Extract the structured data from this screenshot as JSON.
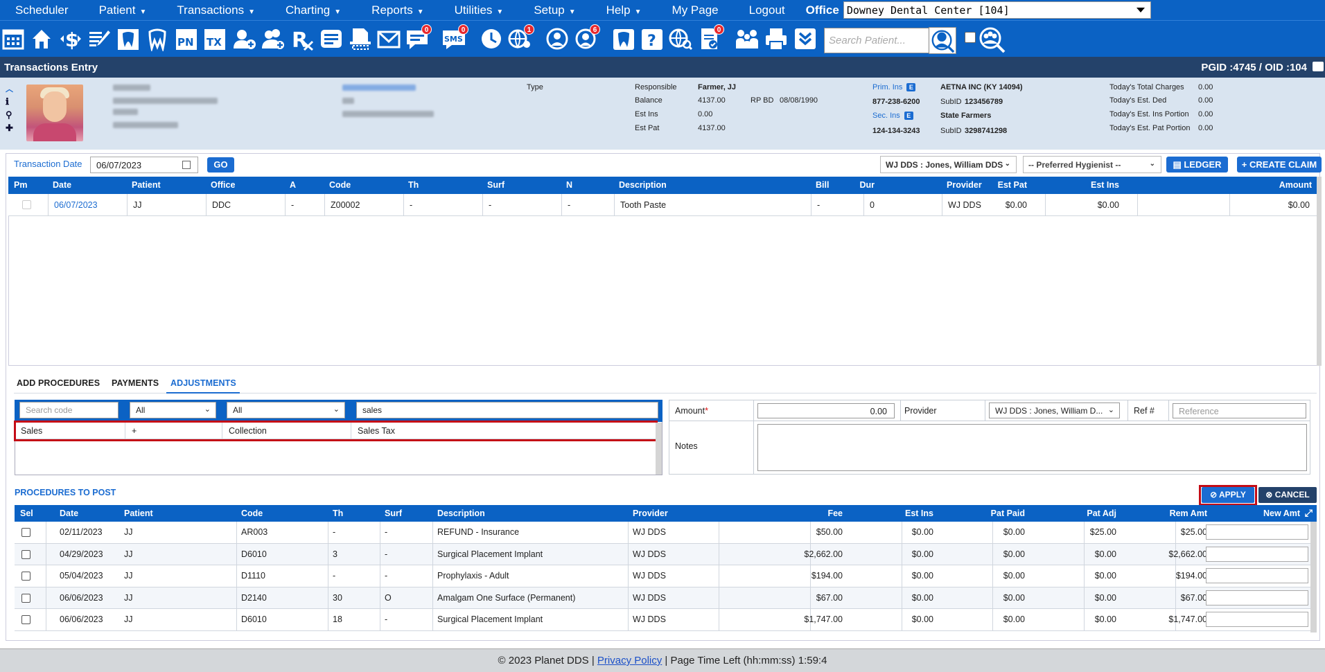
{
  "menu": {
    "items": [
      "Scheduler",
      "Patient",
      "Transactions",
      "Charting",
      "Reports",
      "Utilities",
      "Setup",
      "Help",
      "My Page",
      "Logout"
    ],
    "office_label": "Office",
    "office_value": "Downey Dental Center [104]"
  },
  "toolbar": {
    "search_placeholder": "Search Patient...",
    "badges": {
      "messages": "0",
      "sms": "0",
      "globe": "1",
      "recall": "6",
      "forms": "0"
    },
    "pn_label": "PN",
    "tx_label": "TX",
    "sms_label": "SMS"
  },
  "title": {
    "left": "Transactions Entry",
    "right": "PGID :4745  /  OID :104"
  },
  "patient": {
    "type_label": "Type",
    "responsible_label": "Responsible",
    "responsible": "Farmer, JJ",
    "balance_label": "Balance",
    "balance": "4137.00",
    "rpbd_label": "RP BD",
    "rpbd": "08/08/1990",
    "estins_label": "Est Ins",
    "estins": "0.00",
    "estpat_label": "Est Pat",
    "estpat": "4137.00",
    "prim_ins_label": "Prim. Ins",
    "prim_ins": "AETNA INC (KY 14094)",
    "prim_phone": "877-238-6200",
    "prim_subid_label": "SubID",
    "prim_subid": "123456789",
    "sec_ins_label": "Sec. Ins",
    "sec_ins": "State Farmers",
    "sec_phone": "124-134-3243",
    "sec_subid_label": "SubID",
    "sec_subid": "3298741298",
    "totals": [
      {
        "label": "Today's Total Charges",
        "value": "0.00"
      },
      {
        "label": "Today's Est. Ded",
        "value": "0.00"
      },
      {
        "label": "Today's Est. Ins Portion",
        "value": "0.00"
      },
      {
        "label": "Today's Est. Pat Portion",
        "value": "0.00"
      }
    ]
  },
  "txbar": {
    "date_label": "Transaction Date",
    "date": "06/07/2023",
    "go": "GO",
    "provider": "WJ DDS : Jones, William DDS",
    "hygienist": "-- Preferred Hygienist --",
    "ledger": "LEDGER",
    "create_claim": "CREATE CLAIM"
  },
  "tx_grid": {
    "headers": [
      "Pm",
      "Date",
      "Patient",
      "Office",
      "A",
      "Code",
      "Th",
      "Surf",
      "N",
      "Description",
      "Bill",
      "Dur",
      "Provider",
      "Est Pat",
      "Est Ins",
      "Amount"
    ],
    "row": [
      "",
      "06/07/2023",
      "JJ",
      "DDC",
      "-",
      "Z00002",
      "-",
      "-",
      "-",
      "Tooth Paste",
      "-",
      "0",
      "WJ DDS",
      "$0.00",
      "$0.00",
      "$0.00"
    ]
  },
  "tabs": [
    "ADD PROCEDURES",
    "PAYMENTS",
    "ADJUSTMENTS"
  ],
  "adjust": {
    "search_code_placeholder": "Search code",
    "filter1": "All",
    "filter2": "All",
    "search_text": "sales",
    "result": [
      "Sales",
      "+",
      "Collection",
      "Sales Tax"
    ]
  },
  "form": {
    "amount_label": "Amount",
    "amount_req": "*",
    "amount": "0.00",
    "provider_label": "Provider",
    "provider": "WJ DDS : Jones, William D...",
    "ref_label": "Ref #",
    "ref_placeholder": "Reference",
    "notes_label": "Notes"
  },
  "post": {
    "label": "PROCEDURES TO POST",
    "apply": "APPLY",
    "cancel": "CANCEL",
    "headers": [
      "Sel",
      "Date",
      "Patient",
      "Code",
      "Th",
      "Surf",
      "Description",
      "Provider",
      "Fee",
      "Est Ins",
      "Pat Paid",
      "Pat Adj",
      "Rem Amt",
      "New Amt"
    ],
    "rows": [
      [
        "02/11/2023",
        "JJ",
        "AR003",
        "-",
        "-",
        "REFUND - Insurance",
        "WJ DDS",
        "$50.00",
        "$0.00",
        "$0.00",
        "$25.00",
        "$25.00"
      ],
      [
        "04/29/2023",
        "JJ",
        "D6010",
        "3",
        "-",
        "Surgical Placement Implant",
        "WJ DDS",
        "$2,662.00",
        "$0.00",
        "$0.00",
        "$0.00",
        "$2,662.00"
      ],
      [
        "05/04/2023",
        "JJ",
        "D1110",
        "-",
        "-",
        "Prophylaxis - Adult",
        "WJ DDS",
        "$194.00",
        "$0.00",
        "$0.00",
        "$0.00",
        "$194.00"
      ],
      [
        "06/06/2023",
        "JJ",
        "D2140",
        "30",
        "O",
        "Amalgam One Surface (Permanent)",
        "WJ DDS",
        "$67.00",
        "$0.00",
        "$0.00",
        "$0.00",
        "$67.00"
      ],
      [
        "06/06/2023",
        "JJ",
        "D6010",
        "18",
        "-",
        "Surgical Placement Implant",
        "WJ DDS",
        "$1,747.00",
        "$0.00",
        "$0.00",
        "$0.00",
        "$1,747.00"
      ]
    ]
  },
  "footer": {
    "copyright": "© 2023 Planet DDS | ",
    "privacy": "Privacy Policy",
    "time_left": " |  Page Time Left (hh:mm:ss) 1:59:4"
  }
}
